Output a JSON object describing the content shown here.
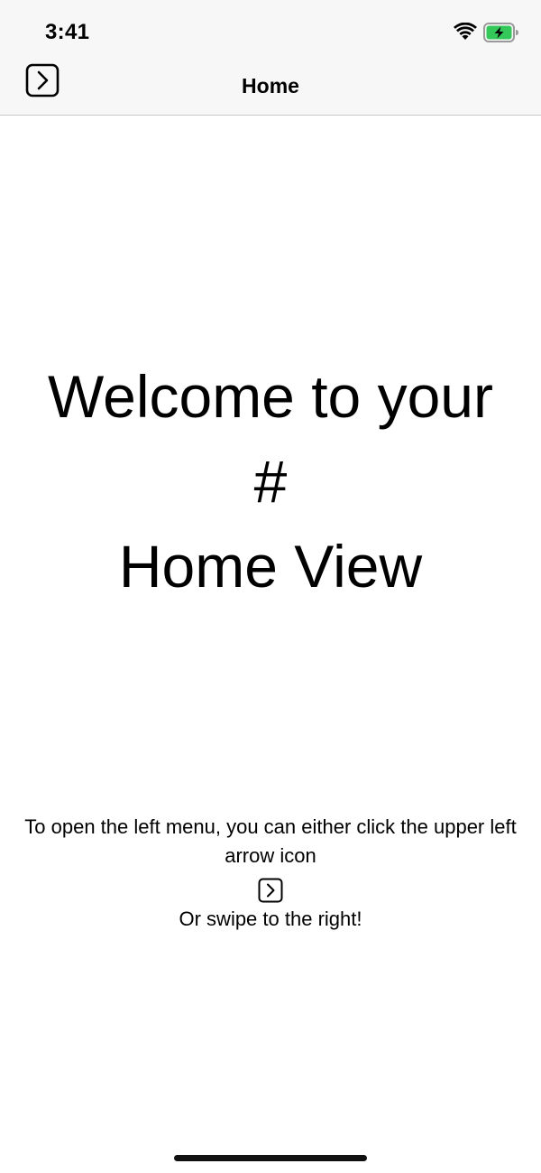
{
  "status_bar": {
    "time": "3:41",
    "icons": [
      "wifi-icon",
      "battery-charging-icon"
    ],
    "battery_color": "#34c759"
  },
  "nav": {
    "title": "Home",
    "menu_icon": "chevron-right-square-icon"
  },
  "main": {
    "welcome_lines": [
      "Welcome to your",
      "#",
      "Home View"
    ],
    "instructions": {
      "line1": "To open the left menu, you can either click the upper left arrow icon",
      "icon": "chevron-right-square-icon",
      "line2": "Or swipe to the right!"
    }
  },
  "colors": {
    "bar_background": "#f7f7f7",
    "text": "#000000",
    "page_background": "#ffffff"
  }
}
